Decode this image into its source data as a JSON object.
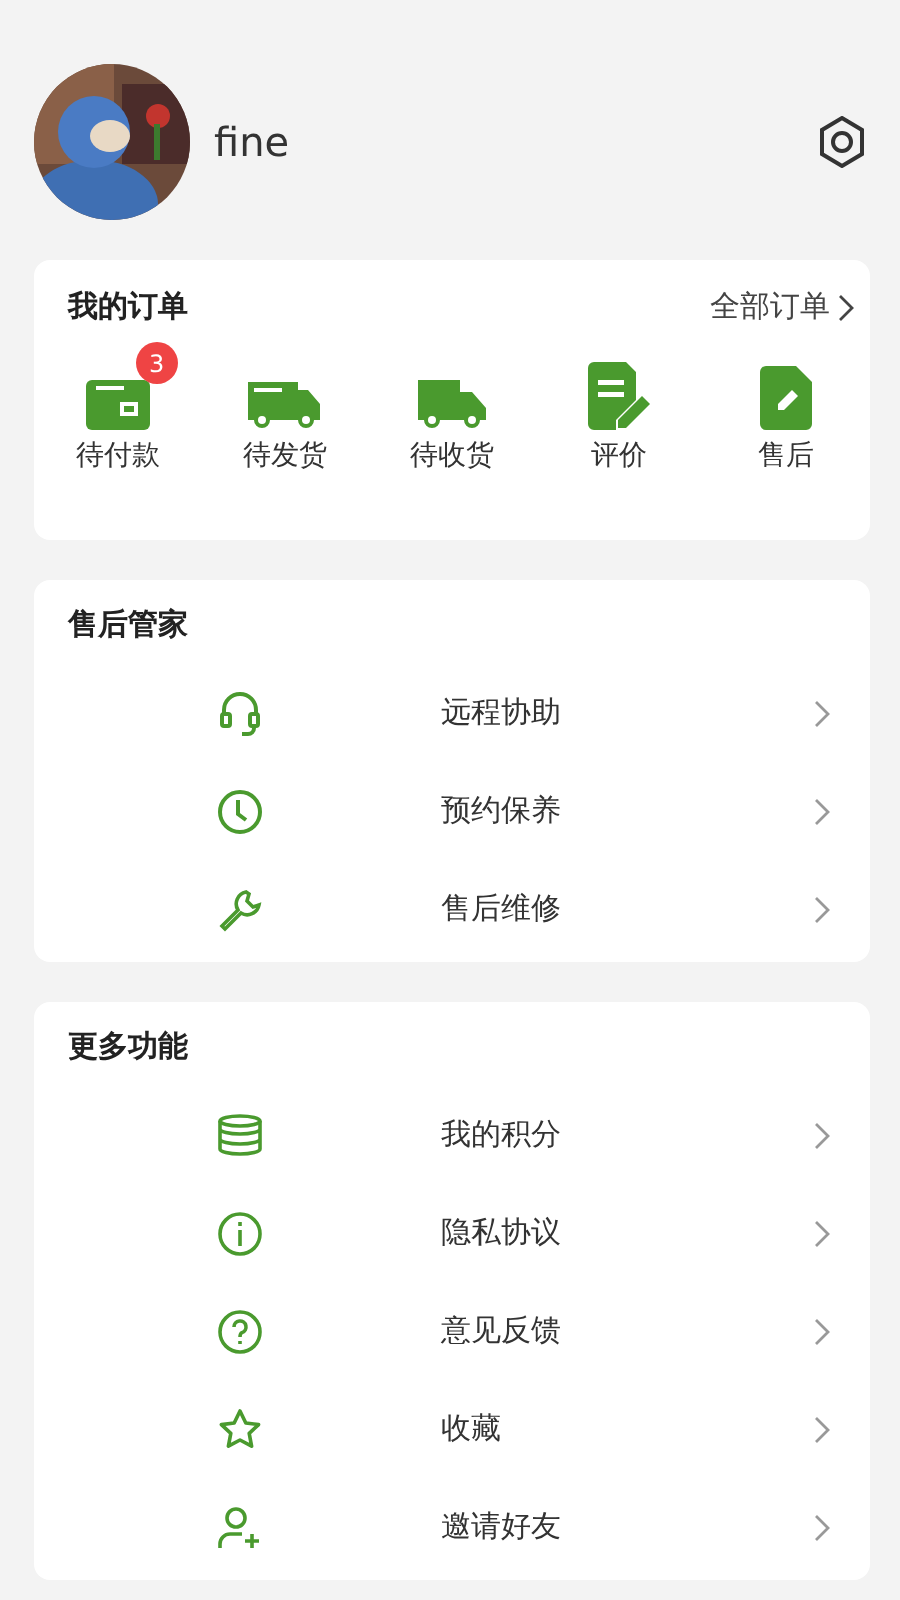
{
  "profile": {
    "name": "fine"
  },
  "orders": {
    "title": "我的订单",
    "all_link": "全部订单",
    "items": [
      {
        "kind": "wallet",
        "label": "待付款",
        "badge": "3"
      },
      {
        "kind": "van",
        "label": "待发货"
      },
      {
        "kind": "truck",
        "label": "待收货"
      },
      {
        "kind": "review",
        "label": "评价"
      },
      {
        "kind": "document",
        "label": "售后"
      }
    ]
  },
  "sections": [
    {
      "title": "售后管家",
      "items": [
        {
          "kind": "headset",
          "label": "远程协助"
        },
        {
          "kind": "clock",
          "label": "预约保养"
        },
        {
          "kind": "wrench",
          "label": "售后维修"
        }
      ]
    },
    {
      "title": "更多功能",
      "items": [
        {
          "kind": "coins",
          "label": "我的积分"
        },
        {
          "kind": "info",
          "label": "隐私协议"
        },
        {
          "kind": "question",
          "label": "意见反馈"
        },
        {
          "kind": "star",
          "label": "收藏"
        },
        {
          "kind": "user-plus",
          "label": "邀请好友"
        }
      ]
    }
  ]
}
